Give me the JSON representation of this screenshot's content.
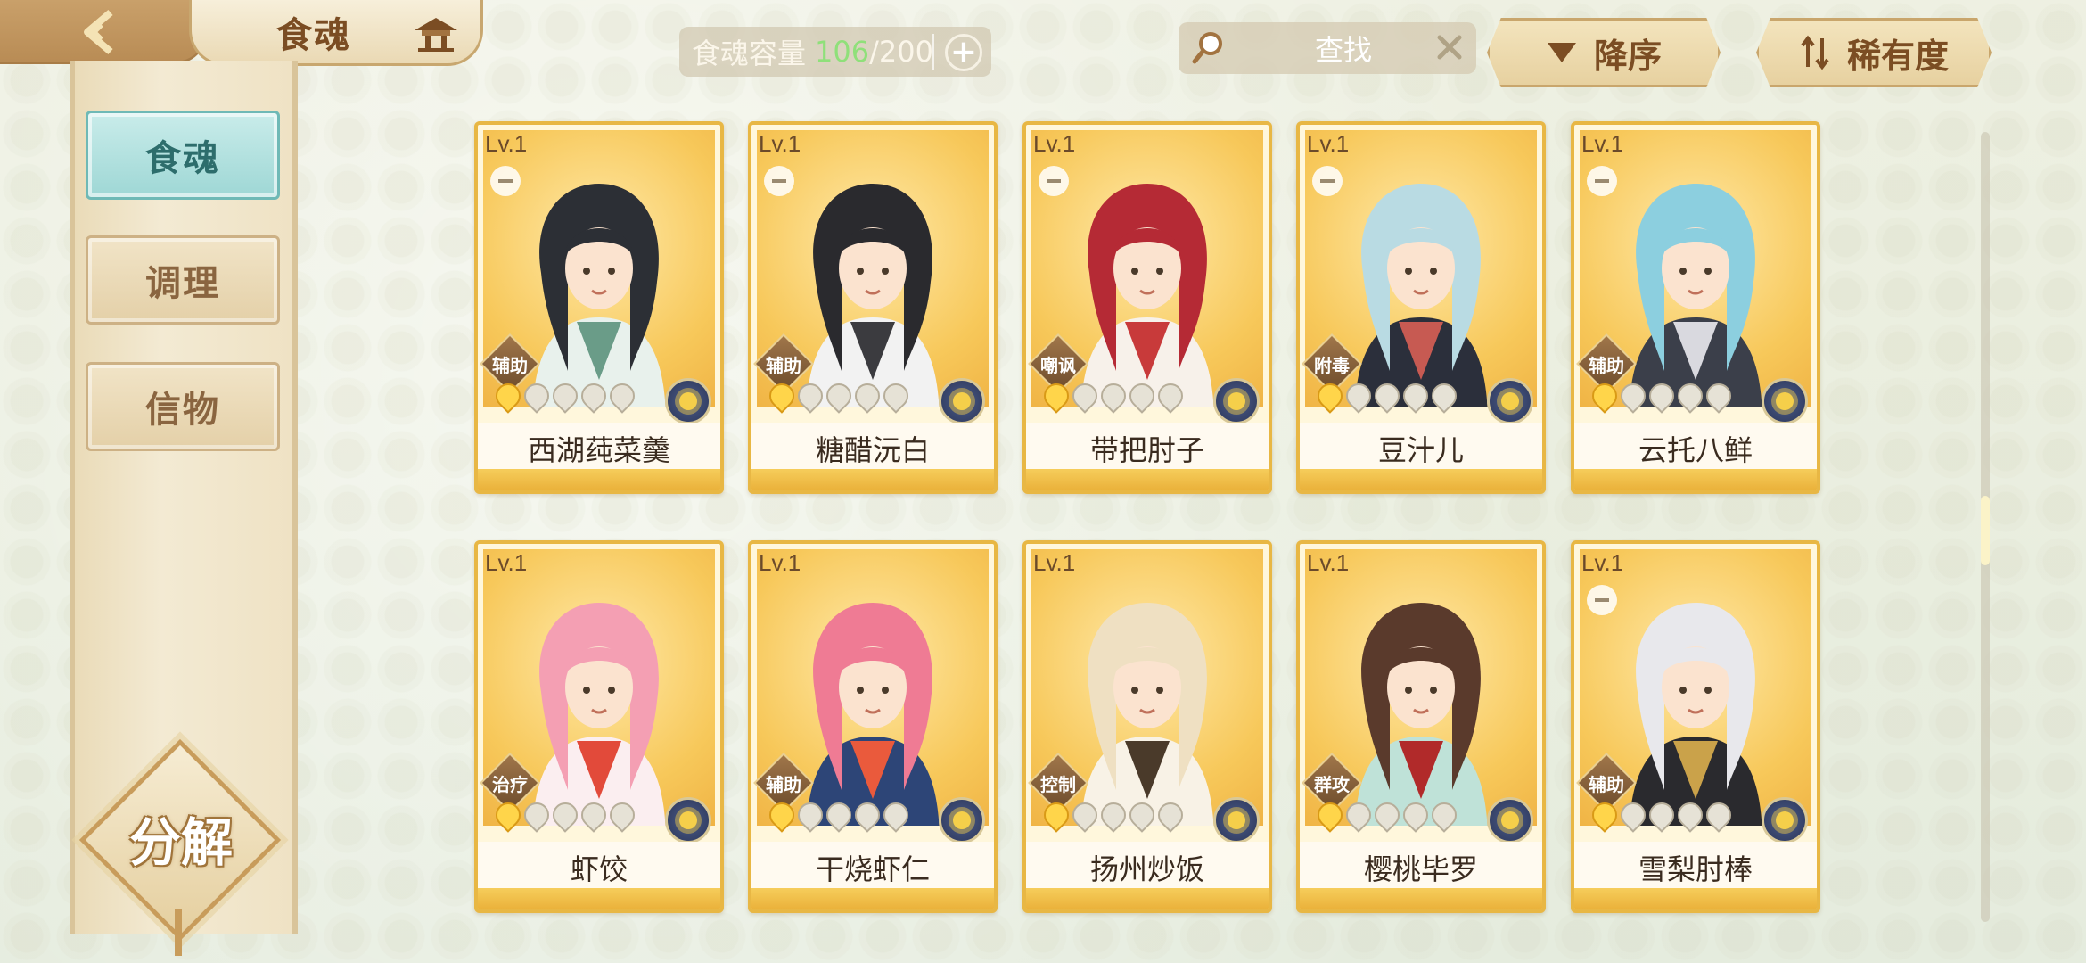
{
  "header": {
    "title": "食魂",
    "capacity_label": "食魂容量",
    "capacity_used": "106",
    "capacity_sep": "/",
    "capacity_max": "200",
    "search_placeholder": "查找",
    "sort_desc_label": "降序",
    "sort_rarity_label": "稀有度"
  },
  "sidebar": {
    "items": [
      {
        "label": "食魂",
        "active": true
      },
      {
        "label": "调理",
        "active": false
      },
      {
        "label": "信物",
        "active": false
      }
    ],
    "decompose_label": "分解"
  },
  "cards": [
    {
      "level": "Lv.1",
      "role": "辅助",
      "name": "西湖莼菜羹",
      "stars": 1,
      "max_stars": 5,
      "locked_icon": true,
      "palette": [
        "#2c2f35",
        "#e8f1ec",
        "#6a9c88"
      ]
    },
    {
      "level": "Lv.1",
      "role": "辅助",
      "name": "糖醋沅白",
      "stars": 1,
      "max_stars": 5,
      "locked_icon": true,
      "palette": [
        "#2a2a2e",
        "#f2f2f2",
        "#3b3b3f"
      ]
    },
    {
      "level": "Lv.1",
      "role": "嘲讽",
      "name": "带把肘子",
      "stars": 1,
      "max_stars": 5,
      "locked_icon": true,
      "palette": [
        "#b52a35",
        "#f7f1ea",
        "#c83a3a"
      ]
    },
    {
      "level": "Lv.1",
      "role": "附毒",
      "name": "豆汁儿",
      "stars": 1,
      "max_stars": 5,
      "locked_icon": true,
      "palette": [
        "#b9dbe3",
        "#2b2f3b",
        "#c75a52"
      ]
    },
    {
      "level": "Lv.1",
      "role": "辅助",
      "name": "云托八鲜",
      "stars": 1,
      "max_stars": 5,
      "locked_icon": true,
      "palette": [
        "#8ccfdf",
        "#3b3f4a",
        "#d9d9df"
      ]
    },
    {
      "level": "Lv.1",
      "role": "治疗",
      "name": "虾饺",
      "stars": 1,
      "max_stars": 5,
      "locked_icon": false,
      "palette": [
        "#f49fb3",
        "#fbeef0",
        "#e24a3a"
      ]
    },
    {
      "level": "Lv.1",
      "role": "辅助",
      "name": "干烧虾仁",
      "stars": 1,
      "max_stars": 5,
      "locked_icon": false,
      "palette": [
        "#ef7b94",
        "#2d4577",
        "#ea5a3c"
      ]
    },
    {
      "level": "Lv.1",
      "role": "控制",
      "name": "扬州炒饭",
      "stars": 1,
      "max_stars": 5,
      "locked_icon": false,
      "palette": [
        "#efe0c2",
        "#f8f2e6",
        "#4a3a2a"
      ]
    },
    {
      "level": "Lv.1",
      "role": "群攻",
      "name": "樱桃毕罗",
      "stars": 1,
      "max_stars": 5,
      "locked_icon": false,
      "palette": [
        "#5a3a2c",
        "#bfe2d8",
        "#b12a2a"
      ]
    },
    {
      "level": "Lv.1",
      "role": "辅助",
      "name": "雪梨肘棒",
      "stars": 1,
      "max_stars": 5,
      "locked_icon": true,
      "palette": [
        "#e8e8ec",
        "#2a2a2e",
        "#caa24a"
      ]
    }
  ],
  "colors": {
    "accent_gold": "#e8b744",
    "brown_text": "#7b4d23",
    "teal_active": "#9ed7d5",
    "capacity_green": "#8fe07a"
  }
}
